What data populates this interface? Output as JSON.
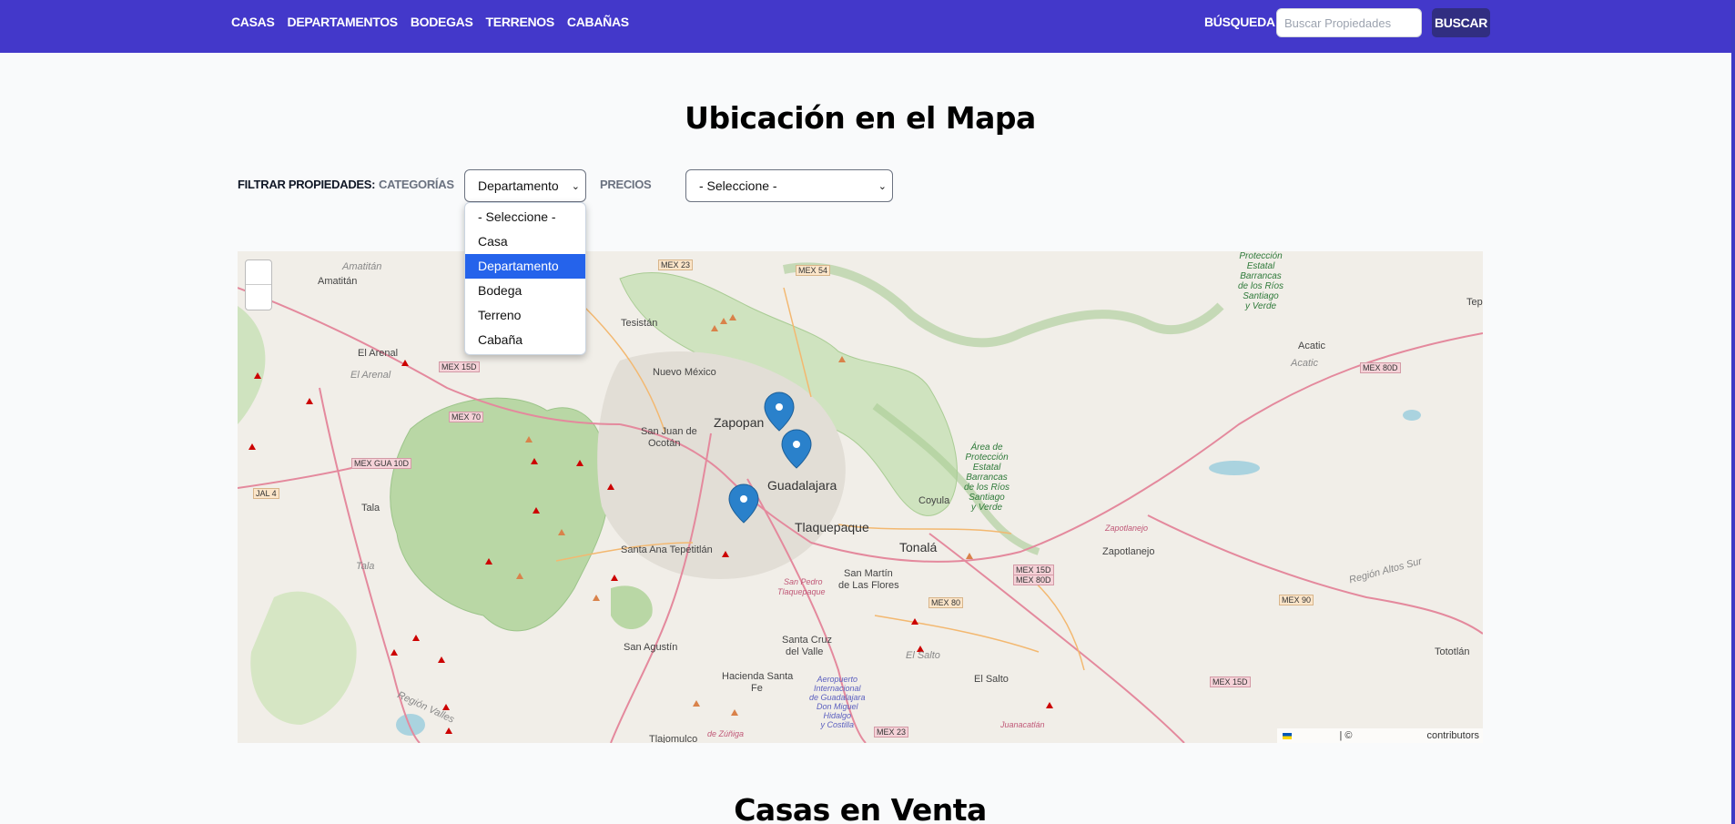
{
  "nav": {
    "items": [
      {
        "label": "CASAS"
      },
      {
        "label": "DEPARTAMENTOS"
      },
      {
        "label": "BODEGAS"
      },
      {
        "label": "TERRENOS"
      },
      {
        "label": "CABAÑAS"
      }
    ],
    "search_label": "BÚSQUEDA",
    "search_placeholder": "Buscar Propiedades",
    "search_button": "BUSCAR"
  },
  "page_title": "Ubicación en el Mapa",
  "filters": {
    "main_label": "FILTRAR PROPIEDADES:",
    "categories_label": "CATEGORÍAS",
    "categories_selected": "Departamento",
    "categories_options": [
      "- Seleccione -",
      "Casa",
      "Departamento",
      "Bodega",
      "Terreno",
      "Cabaña"
    ],
    "prices_label": "PRECIOS",
    "prices_selected": "- Seleccione -"
  },
  "map": {
    "attribution_sep": "| ©",
    "attribution_text": "contributors",
    "places": {
      "zapopan": "Zapopan",
      "guadalajara": "Guadalajara",
      "tlaquepaque": "Tlaquepaque",
      "tonala": "Tonalá",
      "amatitan": "Amatitán",
      "tesistan": "Tesistán",
      "el_arenal": "El Arenal",
      "el_arenal_dim": "El Arenal",
      "nuevo_mexico": "Nuevo México",
      "san_juan_1": "San Juan de",
      "san_juan_2": "Ocotán",
      "tala": "Tala",
      "tala_dim": "Tala",
      "santa_ana": "Santa Ana Tepetitlán",
      "san_pedro_1": "San Pedro",
      "san_pedro_2": "Tlaquepaque",
      "san_martin_1": "San Martín",
      "san_martin_2": "de Las Flores",
      "coyula": "Coyula",
      "zapotlanejo": "Zapotlanejo",
      "zapotlanejo_pink": "Zapotlanejo",
      "san_agustin": "San Agustín",
      "santa_cruz_1": "Santa Cruz",
      "santa_cruz_2": "del Valle",
      "hacienda_1": "Hacienda Santa",
      "hacienda_2": "Fe",
      "el_salto": "El Salto",
      "el_salto_dim": "El Salto",
      "tlajomulco": "Tlajomulco",
      "tlajomulco_dim": "de Zúñiga",
      "acatic": "Acatic",
      "acatic_dim": "Acatic",
      "tototlan": "Tototlán",
      "tep": "Tep",
      "region_valles": "Región Valles",
      "region_altos": "Región Altos Sur",
      "juanacatlan": "Juanacatlán",
      "airport_1": "Aeropuerto",
      "airport_2": "Internacional",
      "airport_3": "de Guadalajara",
      "airport_4": "Don Miguel",
      "airport_5": "Hidalgo",
      "airport_6": "y Costilla",
      "area_1_l1": "Área de",
      "area_1_l2": "Protección",
      "area_1_l3": "Estatal",
      "area_1_l4": "Barrancas",
      "area_1_l5": "de los Ríos",
      "area_1_l6": "Santiago",
      "area_1_l7": "y Verde",
      "area_2_l1": "Protección",
      "area_2_l2": "Estatal",
      "area_2_l3": "Barrancas",
      "area_2_l4": "de los Ríos",
      "area_2_l5": "Santiago",
      "area_2_l6": "y Verde"
    },
    "roads": {
      "mex23_top": "MEX 23",
      "mex54": "MEX 54",
      "mex15d_w": "MEX 15D",
      "mex70": "MEX 70",
      "mexgua10d": "MEX GUA 10D",
      "jal4": "JAL 4",
      "mex80d": "MEX 80D",
      "mex15d_e1": "MEX 15D",
      "mex80d_e1": "MEX 80D",
      "mex80": "MEX 80",
      "mex90": "MEX 90",
      "mex15d_se": "MEX 15D",
      "mex23_bottom": "MEX 23"
    }
  },
  "section_title": "Casas en Venta",
  "colors": {
    "header": "#4338ca",
    "search_button": "#312e81",
    "dropdown_selected": "#2563eb",
    "marker": "#2a81cb"
  }
}
